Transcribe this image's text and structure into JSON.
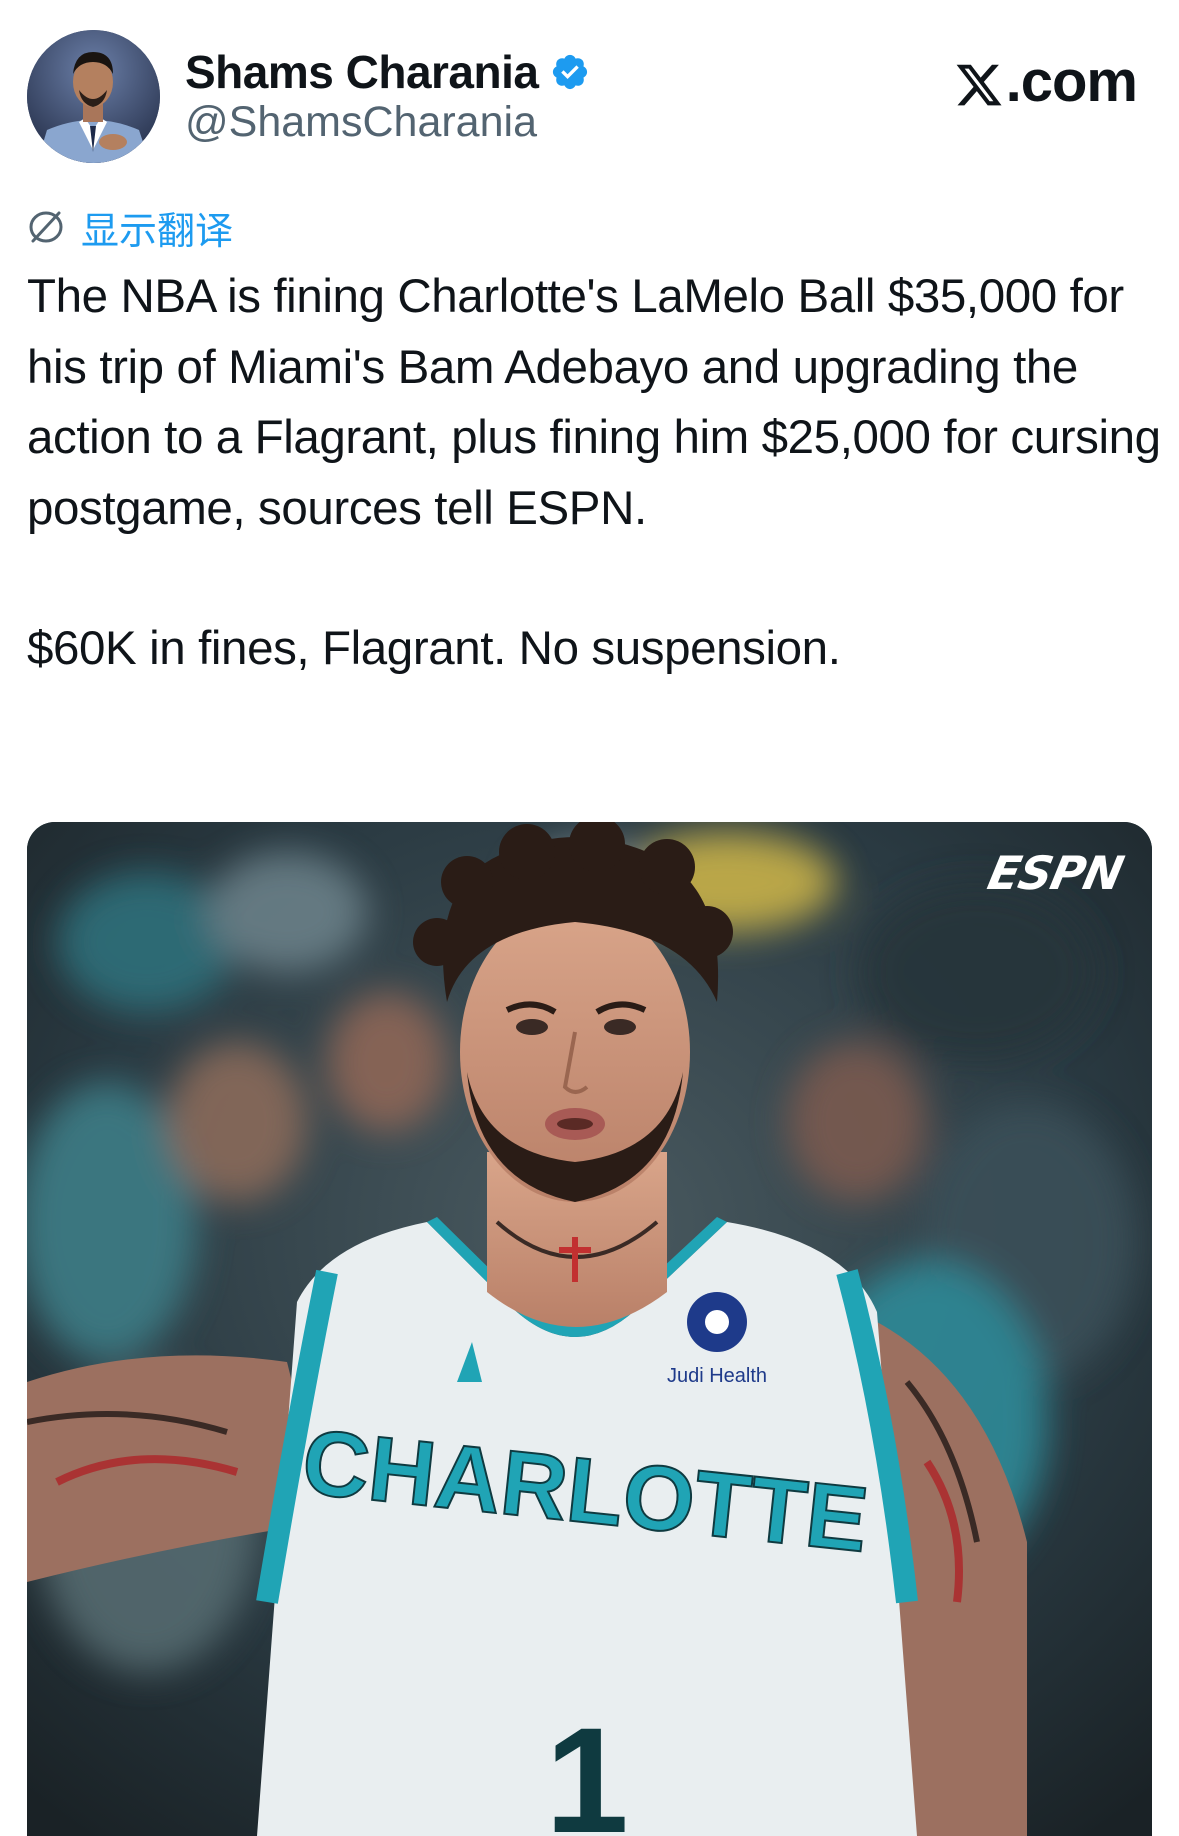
{
  "header": {
    "display_name": "Shams Charania",
    "handle": "@ShamsCharania",
    "verified": true,
    "site_label": ".com",
    "site_logo_icon": "x-logo-icon"
  },
  "translate": {
    "icon": "translate-icon",
    "label": "显示翻译"
  },
  "tweet": {
    "paragraph_1": "The NBA is fining Charlotte's LaMelo Ball $35,000 for his trip of Miami's Bam Adebayo and upgrading the action to a Flagrant, plus fining him $25,000 for cursing postgame, sources tell ESPN.",
    "paragraph_2": "$60K in fines, Flagrant. No suspension."
  },
  "media": {
    "watermark": "ESPN",
    "jersey_text": "CHARLOTTE",
    "sponsor_text": "Judi Health",
    "jersey_number": "1"
  },
  "colors": {
    "accent": "#1d9bf0",
    "secondary_text": "#536471",
    "primary_text": "#0f1419",
    "jersey_teal": "#20a4b5"
  }
}
